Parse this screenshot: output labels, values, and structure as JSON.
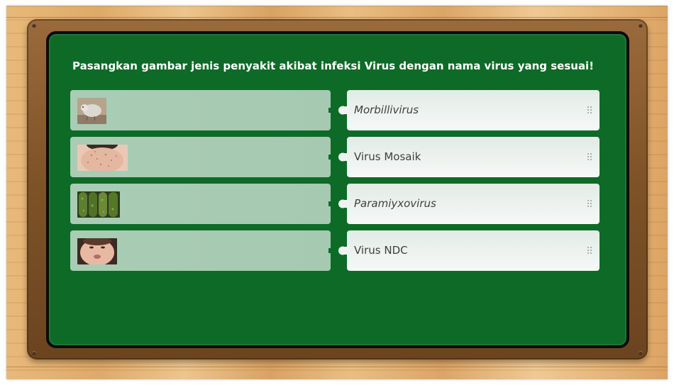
{
  "instruction": "Pasangkan gambar jenis penyakit akibat infeksi Virus dengan nama virus yang sesuai!",
  "pairs_left": [
    {
      "image": "sick-chicken-photo"
    },
    {
      "image": "measles-rash-back-photo"
    },
    {
      "image": "mosaic-cucumber-photo"
    },
    {
      "image": "mumps-child-face-photo"
    }
  ],
  "pairs_right": [
    {
      "label": "Morbillivirus",
      "italic": true
    },
    {
      "label": "Virus Mosaik",
      "italic": false
    },
    {
      "label": "Paramiyxovirus",
      "italic": true
    },
    {
      "label": "Virus NDC",
      "italic": false
    }
  ],
  "icons": {
    "connector_left": "puzzle-tab-icon",
    "connector_right": "puzzle-slot-icon",
    "drag_handle": "drag-grip-icon"
  },
  "colors": {
    "board": "#0d6b27",
    "frame": "#7d5226",
    "left_card": "#a9ccb4",
    "right_card": "#eef3f0",
    "title_text": "#ffffff"
  }
}
